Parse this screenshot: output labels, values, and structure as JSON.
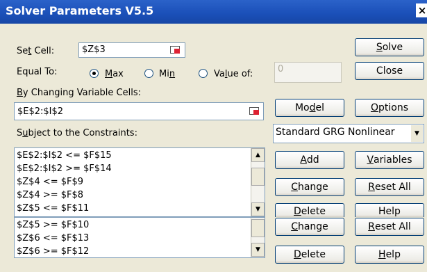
{
  "window": {
    "title": "Solver Parameters V5.5",
    "close_glyph": "×"
  },
  "set_cell": {
    "label_pre": "Se",
    "label_key": "t",
    "label_post": " Cell:",
    "value": "$Z$3"
  },
  "equal_to": {
    "label": "Equal To:",
    "max": {
      "pre": "",
      "key": "M",
      "post": "ax",
      "selected": true
    },
    "min": {
      "pre": "Mi",
      "key": "n",
      "post": "",
      "selected": false
    },
    "value_of": {
      "pre": "Va",
      "key": "l",
      "post": "ue of:",
      "selected": false,
      "value": "0"
    }
  },
  "changing": {
    "label_pre": "",
    "label_key": "B",
    "label_post": "y Changing Variable Cells:",
    "value": "$E$2:$I$2"
  },
  "constraints": {
    "label_pre": "S",
    "label_key": "u",
    "label_post": "bject to the Constraints:"
  },
  "engine": {
    "value": "Standard GRG Nonlinear"
  },
  "list_upper": [
    "$E$2:$I$2 <= $F$15",
    "$E$2:$I$2 >= $F$14",
    "$Z$4 <= $F$9",
    "$Z$4 >= $F$8",
    "$Z$5 <= $F$11"
  ],
  "list_lower": [
    "$Z$5 >= $F$10",
    "$Z$6 <= $F$13",
    "$Z$6 >= $F$12"
  ],
  "buttons": {
    "solve": {
      "pre": "",
      "key": "S",
      "post": "olve"
    },
    "close": {
      "pre": "Close",
      "key": "",
      "post": ""
    },
    "model": {
      "pre": "Mo",
      "key": "d",
      "post": "el"
    },
    "options": {
      "pre": "",
      "key": "O",
      "post": "ptions"
    },
    "add": {
      "pre": "",
      "key": "A",
      "post": "dd"
    },
    "variables": {
      "pre": "",
      "key": "V",
      "post": "ariables"
    },
    "change": {
      "pre": "",
      "key": "C",
      "post": "hange"
    },
    "reset": {
      "pre": "",
      "key": "R",
      "post": "eset All"
    },
    "delete": {
      "pre": "",
      "key": "D",
      "post": "elete"
    },
    "help": {
      "pre": "",
      "key": "H",
      "post": "elp"
    },
    "help_partial": {
      "pre": "Help",
      "key": "",
      "post": ""
    }
  }
}
